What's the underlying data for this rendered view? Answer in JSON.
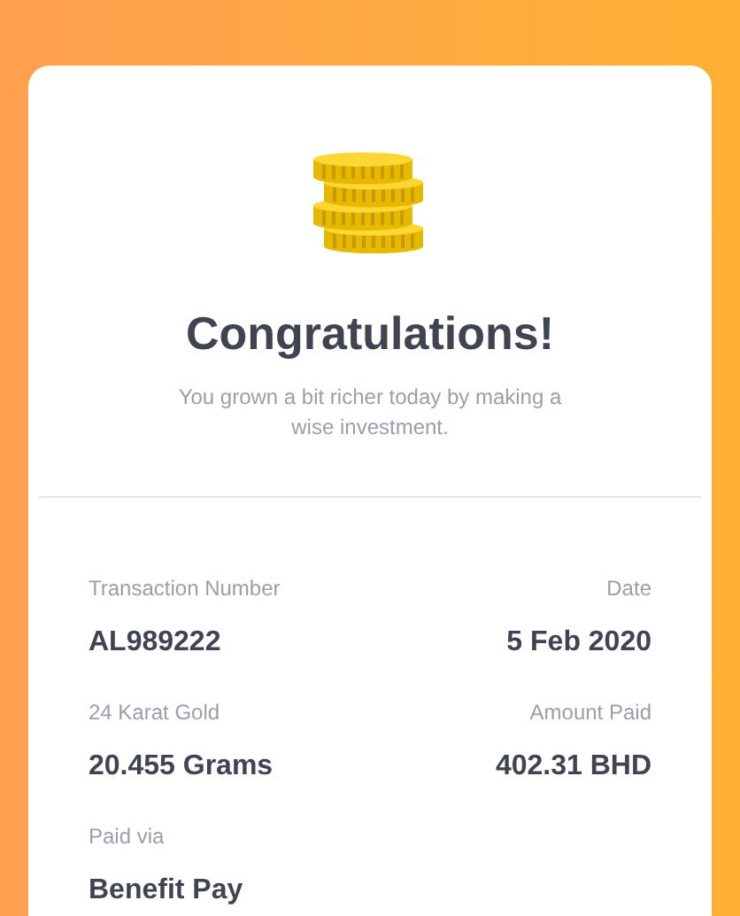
{
  "header": {
    "title": "Congratulations!",
    "message": "You grown a bit richer today by making a wise investment."
  },
  "details": [
    {
      "label": "Transaction Number",
      "value": "AL989222"
    },
    {
      "label": "Date",
      "value": "5 Feb 2020"
    },
    {
      "label": "24 Karat Gold",
      "value": "20.455 Grams"
    },
    {
      "label": "Amount Paid",
      "value": "402.31 BHD"
    },
    {
      "label": "Paid via",
      "value": "Benefit Pay"
    }
  ]
}
